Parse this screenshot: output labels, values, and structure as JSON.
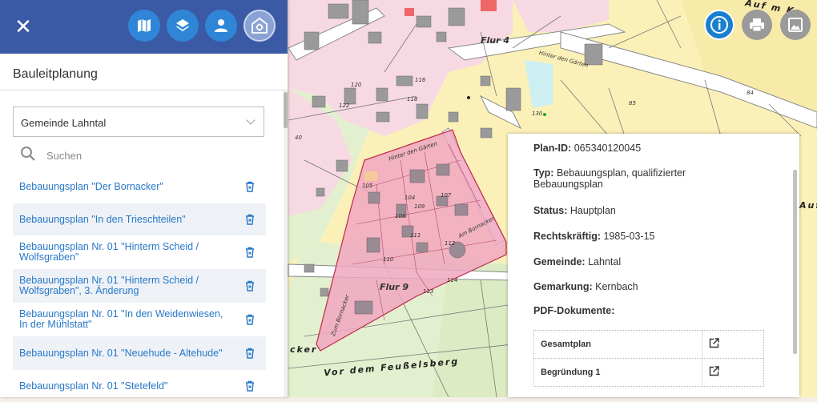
{
  "sidebar": {
    "title": "Bauleitplanung",
    "municipality_select": "Gemeinde Lahntal",
    "search_placeholder": "Suchen",
    "plans": [
      {
        "label": "Bebauungsplan \"Der Bornacker\""
      },
      {
        "label": "Bebauungsplan \"In den Trieschteilen\""
      },
      {
        "label": "Bebauungsplan Nr. 01 \"Hinterm Scheid / Wolfsgraben\""
      },
      {
        "label": "Bebauungsplan Nr. 01 \"Hinterm Scheid / Wolfsgraben\", 3. Änderung"
      },
      {
        "label": "Bebauungsplan Nr. 01 \"In den Weidenwiesen, In der Mühlstatt\""
      },
      {
        "label": "Bebauungsplan Nr. 01 \"Neuehude - Altehude\""
      },
      {
        "label": "Bebauungsplan Nr. 01 \"Stetefeld\""
      }
    ]
  },
  "toolbar": {
    "icons": [
      "close-icon",
      "map-icon",
      "layers-icon",
      "user-icon",
      "house-gear-icon"
    ],
    "right_icons": [
      "info-icon",
      "print-icon",
      "image-icon"
    ]
  },
  "info": {
    "plan_id_label": "Plan-ID:",
    "plan_id": "065340120045",
    "type_label": "Typ:",
    "type": "Bebauungsplan, qualifizierter Bebauungsplan",
    "status_label": "Status:",
    "status": "Hauptplan",
    "legal_label": "Rechtskräftig:",
    "legal": "1985-03-15",
    "municipality_label": "Gemeinde:",
    "municipality": "Lahntal",
    "district_label": "Gemarkung:",
    "district": "Kernbach",
    "pdf_label": "PDF-Dokumente:",
    "documents": [
      {
        "name": "Gesamtplan"
      },
      {
        "name": "Begründung 1"
      }
    ]
  },
  "map": {
    "labels": {
      "flur4": "Flur 4",
      "flur9": "Flur 9",
      "hinter_den_gaerten_1": "Hinter den Gärten",
      "hinter_den_gaerten_2": "Hinter den Gärten",
      "am_bornacker": "Am Bornacker",
      "vor_dem_feusselsberg": "Vor dem Feußelsberg",
      "cker": "cker",
      "auf_m_ke": "Auf m Ke",
      "auf": "Auf",
      "zum_bornacker": "Zum Bornacker",
      "n118": "118",
      "n122": "122",
      "n120": "120",
      "n116": "116",
      "n105": "105",
      "n104": "104",
      "n107": "107",
      "n108": "108",
      "n109": "109",
      "n110": "110",
      "n111": "111",
      "n112": "112",
      "n114": "114",
      "n113": "113",
      "n84": "84",
      "n85": "85",
      "n40": "40",
      "n130": "130"
    },
    "colors": {
      "plan_area": "#f0a7c0",
      "plan_border": "#c0284b",
      "residential": "#f7d9e3",
      "agri": "#fbf1b8",
      "green": "#e3f0cf",
      "building": "#9a9a9a"
    }
  }
}
